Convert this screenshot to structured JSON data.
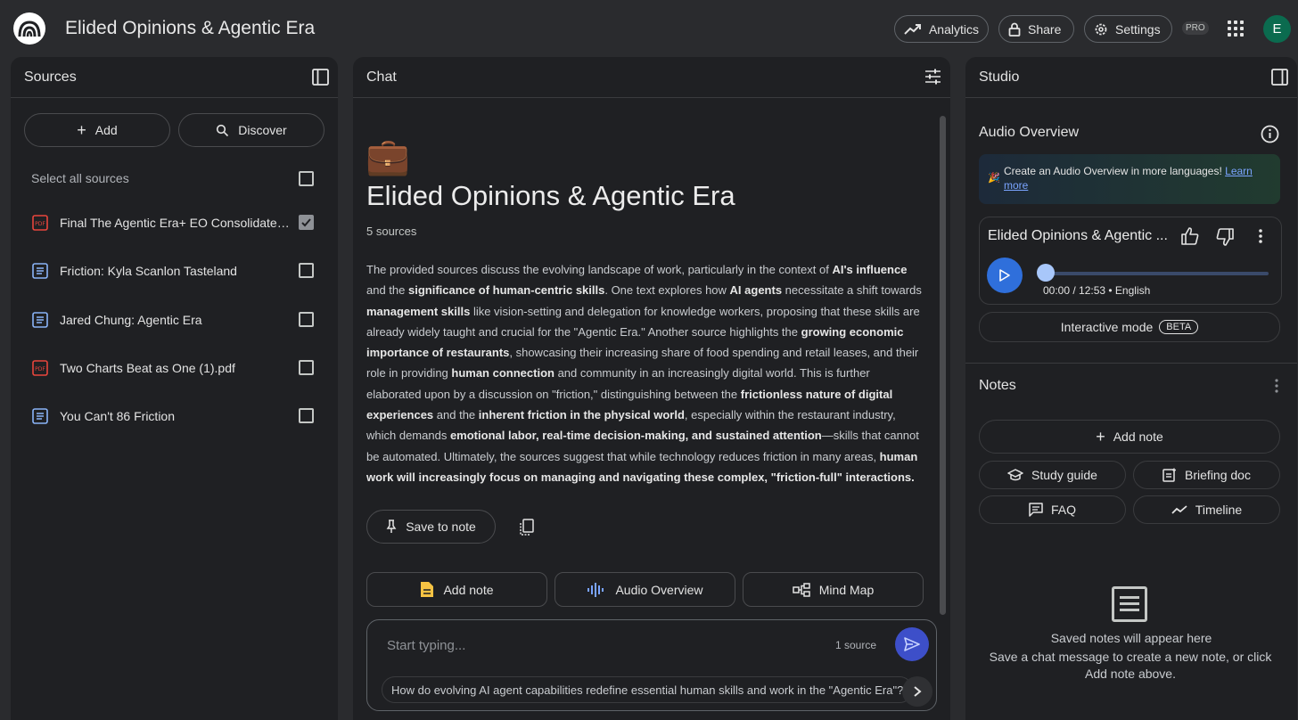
{
  "app": {
    "title": "Elided Opinions & Agentic Era",
    "buttons": {
      "analytics": "Analytics",
      "share": "Share",
      "settings": "Settings"
    },
    "pro_badge": "PRO",
    "avatar_letter": "E"
  },
  "sources": {
    "header": "Sources",
    "add_label": "Add",
    "discover_label": "Discover",
    "select_all": "Select all sources",
    "items": [
      {
        "name": "Final The Agentic Era+ EO Consolidated ...",
        "type": "pdf",
        "checked": true
      },
      {
        "name": "Friction: Kyla Scanlon Tasteland",
        "type": "doc",
        "checked": false
      },
      {
        "name": "Jared Chung: Agentic Era",
        "type": "doc",
        "checked": false
      },
      {
        "name": "Two Charts Beat as One (1).pdf",
        "type": "pdf",
        "checked": false
      },
      {
        "name": "You Can't 86 Friction",
        "type": "doc",
        "checked": false
      }
    ]
  },
  "chat": {
    "header": "Chat",
    "emoji": "💼",
    "title": "Elided Opinions & Agentic Era",
    "source_count": "5 sources",
    "summary_segments": [
      {
        "t": "The provided sources discuss the evolving landscape of work, particularly in the context of ",
        "b": false
      },
      {
        "t": "AI's influence",
        "b": true
      },
      {
        "t": " and the ",
        "b": false
      },
      {
        "t": "significance of human-centric skills",
        "b": true
      },
      {
        "t": ". One text explores how ",
        "b": false
      },
      {
        "t": "AI agents",
        "b": true
      },
      {
        "t": " necessitate a shift towards ",
        "b": false
      },
      {
        "t": "management skills",
        "b": true
      },
      {
        "t": " like vision-setting and delegation for knowledge workers, proposing that these skills are already widely taught and crucial for the \"Agentic Era.\" Another source highlights the ",
        "b": false
      },
      {
        "t": "growing economic importance of restaurants",
        "b": true
      },
      {
        "t": ", showcasing their increasing share of food spending and retail leases, and their role in providing ",
        "b": false
      },
      {
        "t": "human connection",
        "b": true
      },
      {
        "t": " and community in an increasingly digital world. This is further elaborated upon by a discussion on \"friction,\" distinguishing between the ",
        "b": false
      },
      {
        "t": "frictionless nature of digital experiences",
        "b": true
      },
      {
        "t": " and the ",
        "b": false
      },
      {
        "t": "inherent friction in the physical world",
        "b": true
      },
      {
        "t": ", especially within the restaurant industry, which demands ",
        "b": false
      },
      {
        "t": "emotional labor, real-time decision-making, and sustained attention",
        "b": true
      },
      {
        "t": "—skills that cannot be automated. Ultimately, the sources suggest that while technology reduces friction in many areas, ",
        "b": false
      },
      {
        "t": "human work will increasingly focus on managing and navigating these complex, \"friction-full\" interactions.",
        "b": true
      }
    ],
    "save_to_note": "Save to note",
    "actions": {
      "add_note": "Add note",
      "audio_overview": "Audio Overview",
      "mind_map": "Mind Map"
    },
    "input_placeholder": "Start typing...",
    "input_source_count": "1 source",
    "suggestion": "How do evolving AI agent capabilities redefine essential human skills and work in the \"Agentic Era\"?"
  },
  "studio": {
    "header": "Studio",
    "audio_overview_title": "Audio Overview",
    "banner_text": "Create an Audio Overview in more languages!",
    "banner_link": "Learn more",
    "audio_card": {
      "title": "Elided Opinions & Agentic ...",
      "time": "00:00 / 12:53 • English",
      "progress": 0.0
    },
    "interactive_mode": "Interactive mode",
    "beta": "BETA",
    "notes_title": "Notes",
    "add_note": "Add note",
    "study_guide": "Study guide",
    "briefing_doc": "Briefing doc",
    "faq": "FAQ",
    "timeline": "Timeline",
    "empty_title": "Saved notes will appear here",
    "empty_desc": "Save a chat message to create a new note, or click Add note above."
  },
  "colors": {
    "background": "#2a2b2e",
    "panel": "#1f2023",
    "accent_blue": "#2f6fdb",
    "pdf_red": "#e8453c",
    "doc_blue": "#8ab4f8"
  }
}
